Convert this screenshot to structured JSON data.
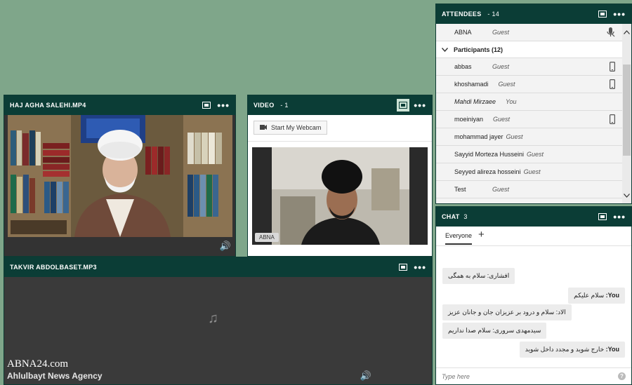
{
  "watermark": {
    "brand": "ABNA24.com",
    "agency": "Ahlulbayt News Agency"
  },
  "pods": {
    "speaker_video": {
      "title": "HAJ AGHA SALEHI.MP4"
    },
    "webcam_video": {
      "title": "VIDEO",
      "count": "- 1",
      "start_webcam_label": "Start My Webcam",
      "stream_name": "ABNA"
    },
    "audio_file": {
      "title": "TAKVIR ABDOLBASET.MP3"
    }
  },
  "attendees": {
    "title": "ATTENDEES",
    "count": "- 14",
    "host": {
      "name": "ABNA",
      "role": "Guest",
      "device": "mic-muted-icon"
    },
    "group_label": "Participants (12)",
    "participants": [
      {
        "name": "abbas",
        "role": "Guest",
        "device": "mobile-icon"
      },
      {
        "name": "khoshamadi",
        "role": "Guest",
        "device": "mobile-icon"
      },
      {
        "name": "Mahdi Mirzaee",
        "role": "You",
        "device": ""
      },
      {
        "name": "moeiniyan",
        "role": "Guest",
        "device": "mobile-icon"
      },
      {
        "name": "mohammad jayer",
        "role": "Guest",
        "device": ""
      },
      {
        "name": "Sayyid Morteza Husseini",
        "role": "Guest",
        "device": ""
      },
      {
        "name": "Seyyed alireza hosseini",
        "role": "Guest",
        "device": ""
      },
      {
        "name": "Test",
        "role": "Guest",
        "device": ""
      }
    ]
  },
  "chat": {
    "title": "CHAT",
    "count": "3",
    "tab_label": "Everyone",
    "add_tab": "+",
    "messages": [
      {
        "text": "افشاری: سلام به همگی"
      },
      {
        "who": "You:",
        "text": "سلام علیکم"
      },
      {
        "text": "الاد: سلام و درود بر عزیزان جان و جانان عزیز"
      },
      {
        "text": "سیدمهدی سروری: سلام صدا نداریم"
      },
      {
        "who": "You:",
        "text": "خارج شوید و مجدد داخل شوید"
      }
    ],
    "input_placeholder": "Type here"
  }
}
